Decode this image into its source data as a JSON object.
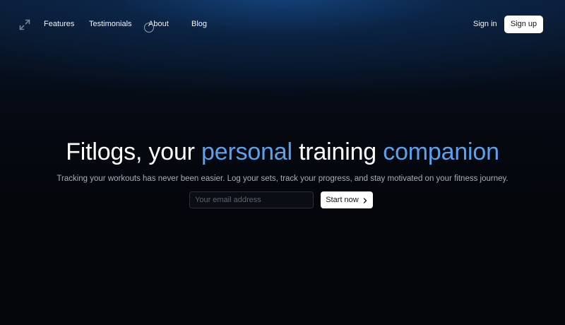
{
  "nav": {
    "logo_icon": "expand-arrows-icon",
    "links": [
      {
        "label": "Features"
      },
      {
        "label": "Testimonials"
      },
      {
        "label": "About"
      },
      {
        "label": "Blog"
      }
    ],
    "sign_in": "Sign in",
    "sign_up": "Sign up"
  },
  "hero": {
    "title_parts": [
      "Fitlogs, your ",
      "personal",
      " training ",
      "companion"
    ],
    "subtitle": "Tracking your workouts has never been easier. Log your sets, track your progress, and stay motivated on your fitness journey.",
    "email": {
      "value": "",
      "placeholder": "Your email address"
    },
    "cta_label": "Start now",
    "cta_icon": "chevron-right-icon"
  },
  "colors": {
    "accent": "#5aa2ec",
    "background": "#04060b",
    "top_glow": "#18528f",
    "button_bg": "#ffffff"
  }
}
